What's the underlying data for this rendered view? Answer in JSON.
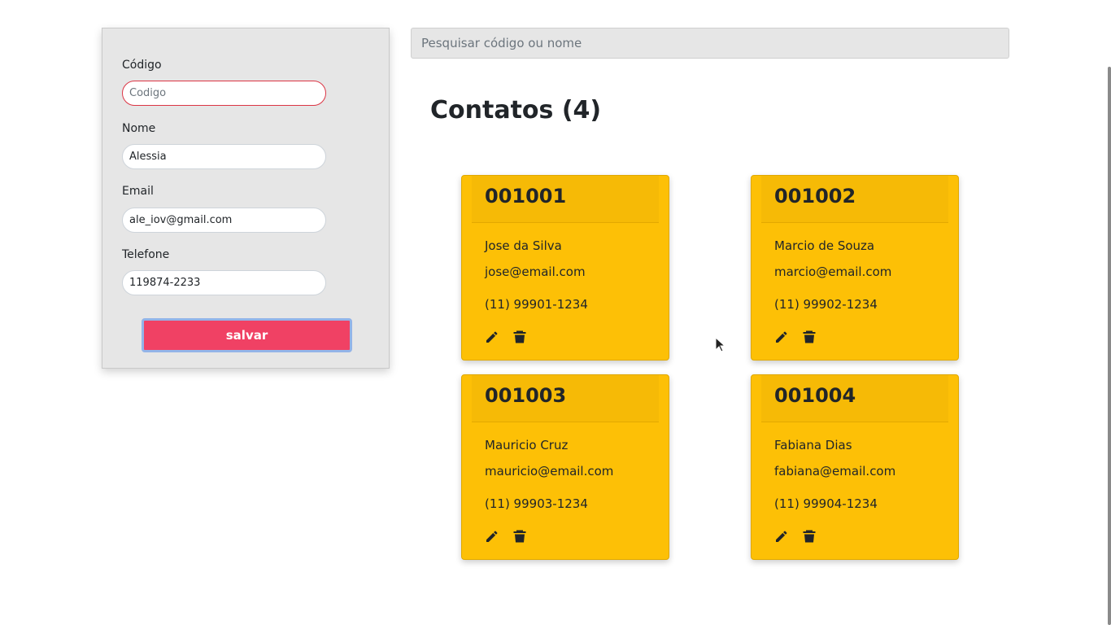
{
  "form": {
    "codigo_label": "Código",
    "codigo_placeholder": "Codigo",
    "codigo_value": "",
    "nome_label": "Nome",
    "nome_value": "Alessia",
    "email_label": "Email",
    "email_value": "ale_iov@gmail.com",
    "telefone_label": "Telefone",
    "telefone_value": "119874-2233",
    "save_label": "salvar"
  },
  "search": {
    "placeholder": "Pesquisar código ou nome"
  },
  "contacts": {
    "title": "Contatos (4)",
    "items": [
      {
        "code": "001001",
        "name": "Jose da Silva",
        "email": "jose@email.com",
        "phone": "(11) 99901-1234"
      },
      {
        "code": "001002",
        "name": "Marcio de Souza",
        "email": "marcio@email.com",
        "phone": "(11) 99902-1234"
      },
      {
        "code": "001003",
        "name": "Mauricio Cruz",
        "email": "mauricio@email.com",
        "phone": "(11) 99903-1234"
      },
      {
        "code": "001004",
        "name": "Fabiana Dias",
        "email": "fabiana@email.com",
        "phone": "(11) 99904-1234"
      }
    ]
  },
  "icons": {
    "edit": "pencil-icon",
    "delete": "trash-icon"
  },
  "colors": {
    "card_bg": "#fdc006",
    "save_button": "#f04164",
    "invalid_border": "#dc3545"
  }
}
